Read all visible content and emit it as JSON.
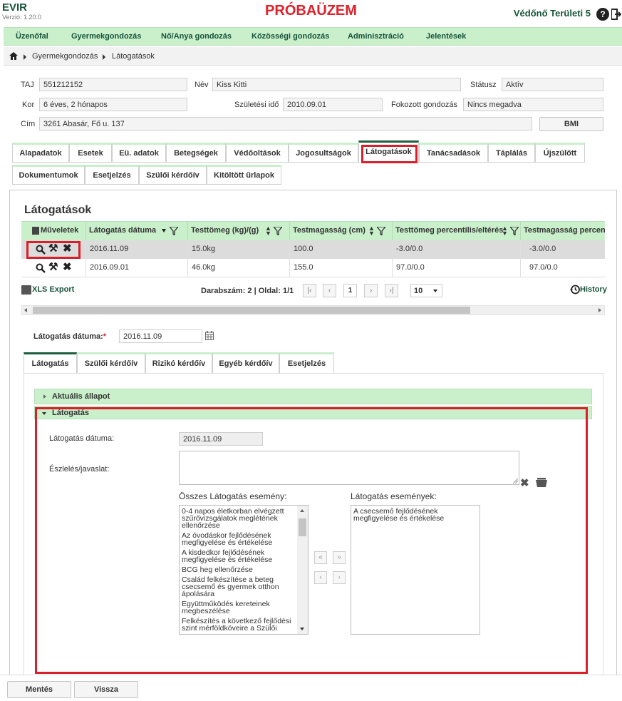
{
  "app": {
    "title": "EVIR",
    "version": "Verzió: 1.20.0",
    "environment": "PRÓBAÜZEM",
    "user": "Védőnő Területi 5",
    "help_symbol": "?"
  },
  "menu": [
    "Üzenőfal",
    "Gyermekgondozás",
    "Nő/Anya gondozás",
    "Közösségi gondozás",
    "Adminisztráció",
    "Jelentések"
  ],
  "breadcrumb": [
    "Gyermekgondozás",
    "Látogatások"
  ],
  "patient": {
    "taj_label": "TAJ",
    "taj": "551212152",
    "nev_label": "Név",
    "nev": "Kiss Kitti",
    "statusz_label": "Státusz",
    "statusz": "Aktív",
    "kor_label": "Kor",
    "kor": "6 éves, 2 hónapos",
    "szul_label": "Születési idő",
    "szul": "2010.09.01",
    "fokozott_label": "Fokozott gondozás",
    "fokozott": "Nincs megadva",
    "cim_label": "Cím",
    "cim": "3261 Abasár, Fő u. 137",
    "bmi_button": "BMI"
  },
  "tabs_row1": [
    "Alapadatok",
    "Esetek",
    "Eü. adatok",
    "Betegségek",
    "Védőoltások",
    "Jogosultságok",
    "Látogatások",
    "Tanácsadások",
    "Táplálás",
    "Újszülött"
  ],
  "tabs_row2": [
    "Dokumentumok",
    "Esetjelzés",
    "Szülői kérdőív",
    "Kitöltött űrlapok"
  ],
  "active_tab": "Látogatások",
  "section_title": "Látogatások",
  "grid": {
    "columns": [
      "Műveletek",
      "Látogatás dátuma",
      "Testtömeg (kg)/(g)",
      "Testmagasság (cm)",
      "Testtömeg percentilis/eltérés",
      "Testmagasság percentilis"
    ],
    "rows": [
      [
        "2016.11.09",
        "15.0kg",
        "100.0",
        "-3.0/0.0",
        "-3.0/0.0"
      ],
      [
        "2016.09.01",
        "46.0kg",
        "155.0",
        "97.0/0.0",
        "97.0/0.0"
      ]
    ]
  },
  "pager": {
    "export": "XLS Export",
    "count_text": "Darabszám: 2 | Oldal: 1/1",
    "page": "1",
    "page_size": "10",
    "history": "History"
  },
  "visit_date": {
    "label": "Látogatás dátuma:",
    "required": "*",
    "value": "2016.11.09"
  },
  "subtabs": [
    "Látogatás",
    "Szülői kérdőív",
    "Rizikó kérdőív",
    "Egyéb kérdőív",
    "Esetjelzés"
  ],
  "accordion": {
    "collapsed": "Aktuális állapot",
    "expanded": "Látogatás"
  },
  "visit_form": {
    "date_label": "Látogatás dátuma:",
    "date_value": "2016.11.09",
    "note_label": "Észlelés/javaslat:",
    "all_events_label": "Összes Látogatás esemény:",
    "selected_events_label": "Látogatás események:",
    "all_events": [
      "0-4 napos életkorban elvégzett szűrővizsgálatok meglétének ellenőrzése",
      "Az óvodáskor fejlődésének megfigyelése és értékelése",
      "A kisdedkor fejlődésének megfigyelése és értékelése",
      "BCG heg ellenőrzése",
      "Család felkészítése a beteg csecsemő és gyermek otthon ápolására",
      "Együttműködés kereteinek megbeszélése",
      "Felkészítés a következő fejlődési szint mérföldköveire a Szülői"
    ],
    "selected_events": [
      "A csecsemő fejlődésének megfigyelése és értékelése"
    ]
  },
  "footer": {
    "save": "Mentés",
    "back": "Vissza"
  },
  "colors": {
    "menu_bg": "#c9efcb",
    "accent": "#1d5e3e",
    "alert": "#d8202a"
  }
}
